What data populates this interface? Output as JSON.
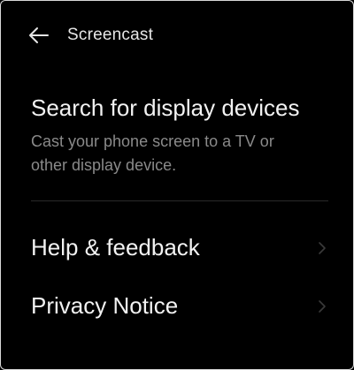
{
  "header": {
    "title": "Screencast",
    "back_icon": "back-arrow-icon"
  },
  "search": {
    "title": "Search for display devices",
    "description": "Cast your phone screen to a TV or other display device."
  },
  "menu": {
    "items": [
      {
        "label": "Help & feedback",
        "icon": "chevron-right-icon"
      },
      {
        "label": "Privacy Notice",
        "icon": "chevron-right-icon"
      }
    ]
  },
  "colors": {
    "background": "#000000",
    "primary_text": "#f2f2f2",
    "secondary_text": "#8a8a8a",
    "chevron": "#3a3a3a",
    "divider": "#2a2a2a"
  }
}
